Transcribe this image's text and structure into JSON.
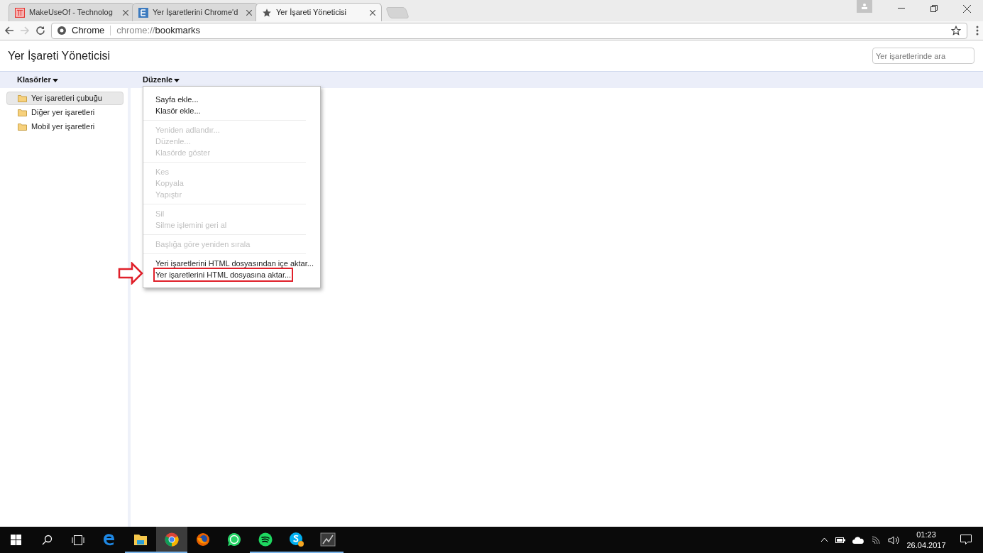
{
  "tabs": [
    {
      "label": "MakeUseOf - Technolog",
      "selected": false
    },
    {
      "label": "Yer İşaretlerini Chrome'd",
      "selected": false
    },
    {
      "label": "Yer İşareti Yöneticisi",
      "selected": true
    }
  ],
  "address": {
    "site": "Chrome",
    "scheme": "chrome://",
    "path": "bookmarks"
  },
  "page_title": "Yer İşareti Yöneticisi",
  "search": {
    "placeholder": "Yer işaretlerinde ara"
  },
  "header": {
    "folders_menu": "Klasörler",
    "organize_menu": "Düzenle"
  },
  "folders": [
    {
      "label": "Yer işaretleri çubuğu",
      "selected": true
    },
    {
      "label": "Diğer yer işaretleri",
      "selected": false
    },
    {
      "label": "Mobil yer işaretleri",
      "selected": false
    }
  ],
  "menu_groups": [
    [
      {
        "label": "Sayfa ekle...",
        "disabled": false,
        "highlighted": false
      },
      {
        "label": "Klasör ekle...",
        "disabled": false,
        "highlighted": false
      }
    ],
    [
      {
        "label": "Yeniden adlandır...",
        "disabled": true,
        "highlighted": false
      },
      {
        "label": "Düzenle...",
        "disabled": true,
        "highlighted": false
      },
      {
        "label": "Klasörde göster",
        "disabled": true,
        "highlighted": false
      }
    ],
    [
      {
        "label": "Kes",
        "disabled": true,
        "highlighted": false
      },
      {
        "label": "Kopyala",
        "disabled": true,
        "highlighted": false
      },
      {
        "label": "Yapıştır",
        "disabled": true,
        "highlighted": false
      }
    ],
    [
      {
        "label": "Sil",
        "disabled": true,
        "highlighted": false
      },
      {
        "label": "Silme işlemini geri al",
        "disabled": true,
        "highlighted": false
      }
    ],
    [
      {
        "label": "Başlığa göre yeniden sırala",
        "disabled": true,
        "highlighted": false
      }
    ],
    [
      {
        "label": "Yeri işaretlerini HTML dosyasından içe aktar...",
        "disabled": false,
        "highlighted": false
      },
      {
        "label": "Yer işaretlerini HTML dosyasına aktar...",
        "disabled": false,
        "highlighted": true
      }
    ]
  ],
  "taskbar": {
    "apps": [
      {
        "kind": "edge",
        "running": false,
        "selected": false
      },
      {
        "kind": "files",
        "running": true,
        "selected": false
      },
      {
        "kind": "chrome",
        "running": true,
        "selected": true
      },
      {
        "kind": "firefox",
        "running": false,
        "selected": false
      },
      {
        "kind": "whatsapp",
        "running": false,
        "selected": false
      },
      {
        "kind": "spotify",
        "running": true,
        "selected": false
      },
      {
        "kind": "skype",
        "running": true,
        "selected": false
      },
      {
        "kind": "nvidia",
        "running": true,
        "selected": false
      }
    ],
    "time": "01:23",
    "date": "26.04.2017"
  }
}
